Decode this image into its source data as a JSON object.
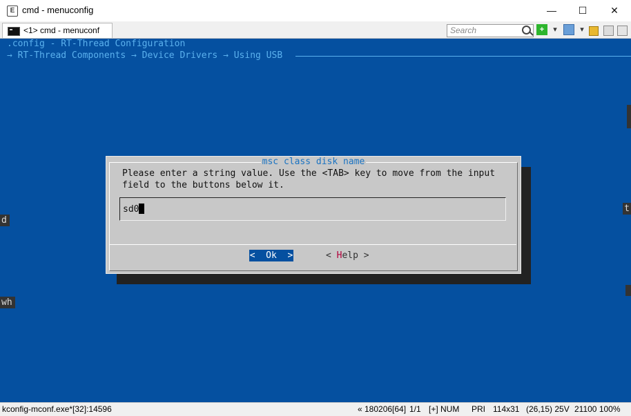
{
  "window": {
    "title": "cmd - menuconfig",
    "app_icon": "E",
    "minimize": "—",
    "maximize": "☐",
    "close": "✕"
  },
  "tab": {
    "label": "<1>  cmd - menuconf"
  },
  "toolbar": {
    "search_placeholder": "Search",
    "add_icon": "plus-icon",
    "add_color": "#2db52d",
    "view_icon": "panel-icon",
    "lock_icon": "lock-icon",
    "settings_icon": "settings-icon",
    "menu_icon": "menu-icon"
  },
  "terminal": {
    "config_line": ".config - RT-Thread Configuration",
    "breadcrumb": "→ RT-Thread Components → Device Drivers → Using USB",
    "left_cell_1": "d",
    "left_cell_2": "wh",
    "right_cell_1": "t",
    "colors": {
      "background": "#0550a0",
      "text": "#5bb1ee"
    }
  },
  "dialog": {
    "title": "msc class disk name",
    "prompt_line1": "Please enter a string value. Use the <TAB> key to move from the input",
    "prompt_line2": "field to the buttons below it.",
    "input_value": "sd0",
    "ok_label": "<  Ok  >",
    "help_prefix": "< ",
    "help_hotkey": "H",
    "help_rest": "elp >"
  },
  "statusbar": {
    "process": "kconfig-mconf.exe*[32]:14596",
    "position": "« 180206[64]",
    "page": "1/1",
    "mode": "[+] NUM",
    "priority": "PRI",
    "size": "114x31",
    "cursor": "(26,15) 25V",
    "extra": "21100 100%"
  }
}
